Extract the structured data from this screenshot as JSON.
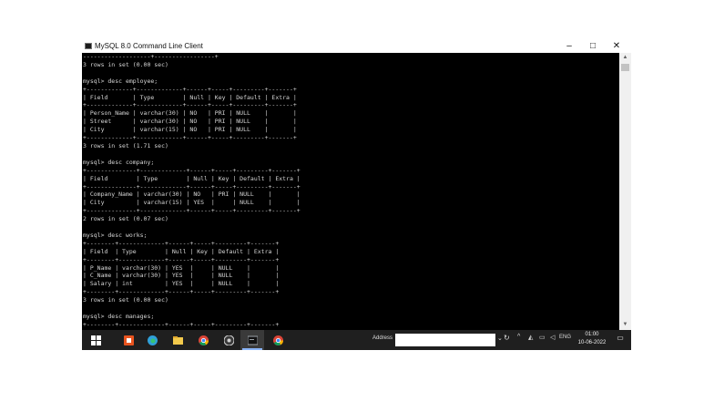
{
  "window": {
    "title": "MySQL 8.0 Command Line Client",
    "controls": {
      "minimize": "–",
      "maximize": "□",
      "close": "✕"
    }
  },
  "console": {
    "lines": [
      "-------------------+-----------------+",
      "3 rows in set (0.00 sec)",
      "",
      "mysql> desc employee;",
      "+-------------+-------------+------+-----+---------+-------+",
      "| Field       | Type        | Null | Key | Default | Extra |",
      "+-------------+-------------+------+-----+---------+-------+",
      "| Person_Name | varchar(30) | NO   | PRI | NULL    |       |",
      "| Street      | varchar(30) | NO   | PRI | NULL    |       |",
      "| City        | varchar(15) | NO   | PRI | NULL    |       |",
      "+-------------+-------------+------+-----+---------+-------+",
      "3 rows in set (1.71 sec)",
      "",
      "mysql> desc company;",
      "+--------------+-------------+------+-----+---------+-------+",
      "| Field        | Type        | Null | Key | Default | Extra |",
      "+--------------+-------------+------+-----+---------+-------+",
      "| Company_Name | varchar(30) | NO   | PRI | NULL    |       |",
      "| City         | varchar(15) | YES  |     | NULL    |       |",
      "+--------------+-------------+------+-----+---------+-------+",
      "2 rows in set (0.07 sec)",
      "",
      "mysql> desc works;",
      "+--------+-------------+------+-----+---------+-------+",
      "| Field  | Type        | Null | Key | Default | Extra |",
      "+--------+-------------+------+-----+---------+-------+",
      "| P_Name | varchar(30) | YES  |     | NULL    |       |",
      "| C_Name | varchar(30) | YES  |     | NULL    |       |",
      "| Salary | int         | YES  |     | NULL    |       |",
      "+--------+-------------+------+-----+---------+-------+",
      "3 rows in set (0.00 sec)",
      "",
      "mysql> desc manages;",
      "+--------+-------------+------+-----+---------+-------+"
    ]
  },
  "taskbar": {
    "apps": [
      {
        "name": "start-icon",
        "color": "#ffffff"
      },
      {
        "name": "office-icon",
        "color": "#e8541f"
      },
      {
        "name": "edge-icon",
        "color": "#2fa0d8"
      },
      {
        "name": "file-explorer-icon",
        "color": "#f2c94c"
      },
      {
        "name": "chrome-icon",
        "color": "#e8b020"
      },
      {
        "name": "obs-icon",
        "color": "#d0d0d0"
      },
      {
        "name": "mysql-console-icon",
        "color": "#9aa0a6"
      },
      {
        "name": "chrome-profile-icon",
        "color": "#e84c3d"
      }
    ],
    "address_label": "Address",
    "address_value": "",
    "tray": {
      "chevron": "^",
      "lang": "ENG"
    },
    "clock_time": "01:00",
    "clock_date": "10-06-2022"
  }
}
